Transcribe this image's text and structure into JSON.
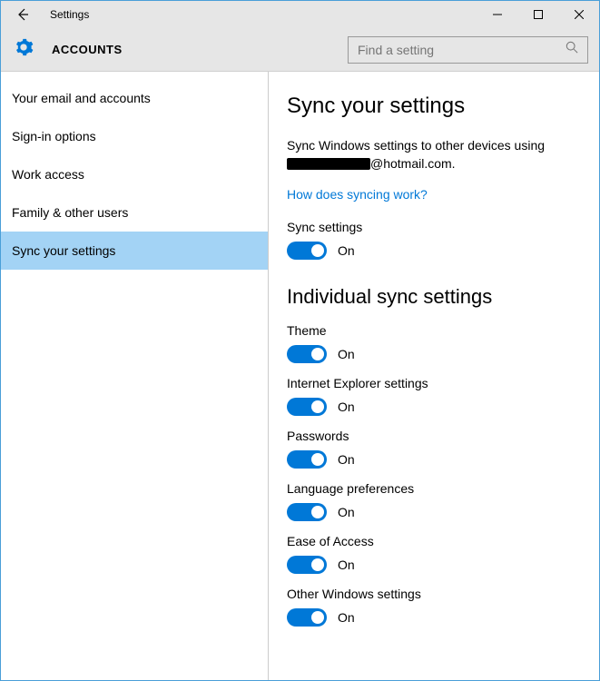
{
  "window": {
    "title": "Settings"
  },
  "header": {
    "heading": "ACCOUNTS",
    "search_placeholder": "Find a setting"
  },
  "sidebar": {
    "items": [
      {
        "label": "Your email and accounts",
        "selected": false
      },
      {
        "label": "Sign-in options",
        "selected": false
      },
      {
        "label": "Work access",
        "selected": false
      },
      {
        "label": "Family & other users",
        "selected": false
      },
      {
        "label": "Sync your settings",
        "selected": true
      }
    ]
  },
  "main": {
    "title": "Sync your settings",
    "desc_prefix": "Sync Windows settings to other devices using",
    "email_suffix": "@hotmail.com.",
    "link": "How does syncing work?",
    "sync_settings_label": "Sync settings",
    "sync_settings_state": "On",
    "section2_title": "Individual sync settings",
    "toggles": [
      {
        "label": "Theme",
        "state": "On"
      },
      {
        "label": "Internet Explorer settings",
        "state": "On"
      },
      {
        "label": "Passwords",
        "state": "On"
      },
      {
        "label": "Language preferences",
        "state": "On"
      },
      {
        "label": "Ease of Access",
        "state": "On"
      },
      {
        "label": "Other Windows settings",
        "state": "On"
      }
    ]
  }
}
